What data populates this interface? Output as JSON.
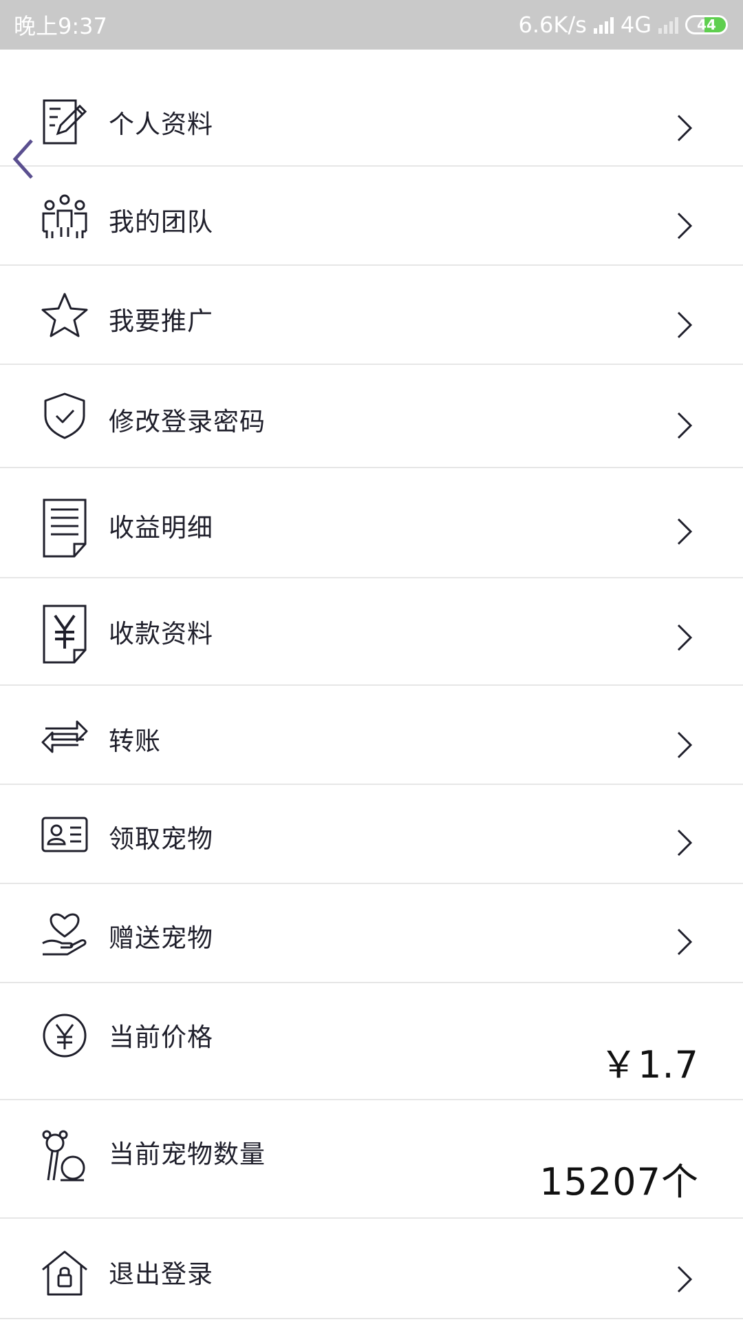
{
  "status_bar": {
    "time": "晚上9:37",
    "speed": "6.6K/s",
    "network": "4G",
    "battery": "44"
  },
  "menu": {
    "items": [
      {
        "label": "个人资料",
        "icon": "edit-icon"
      },
      {
        "label": "我的团队",
        "icon": "team-icon"
      },
      {
        "label": "我要推广",
        "icon": "star-icon"
      },
      {
        "label": "修改登录密码",
        "icon": "shield-icon"
      },
      {
        "label": "收益明细",
        "icon": "document-icon"
      },
      {
        "label": "收款资料",
        "icon": "yuan-document-icon"
      },
      {
        "label": "转账",
        "icon": "transfer-icon"
      },
      {
        "label": "领取宠物",
        "icon": "id-card-icon"
      },
      {
        "label": "赠送宠物",
        "icon": "heart-hand-icon"
      },
      {
        "label": "当前价格",
        "icon": "yuan-circle-icon",
        "value": "￥1.7"
      },
      {
        "label": "当前宠物数量",
        "icon": "pet-icon",
        "value": "15207个"
      },
      {
        "label": "退出登录",
        "icon": "home-lock-icon"
      }
    ]
  },
  "colors": {
    "status_bar_bg": "#c9c9c9",
    "divider": "#e6e6e6",
    "back_chevron": "#5a4f8f",
    "battery_fill": "#5fcf4f"
  }
}
